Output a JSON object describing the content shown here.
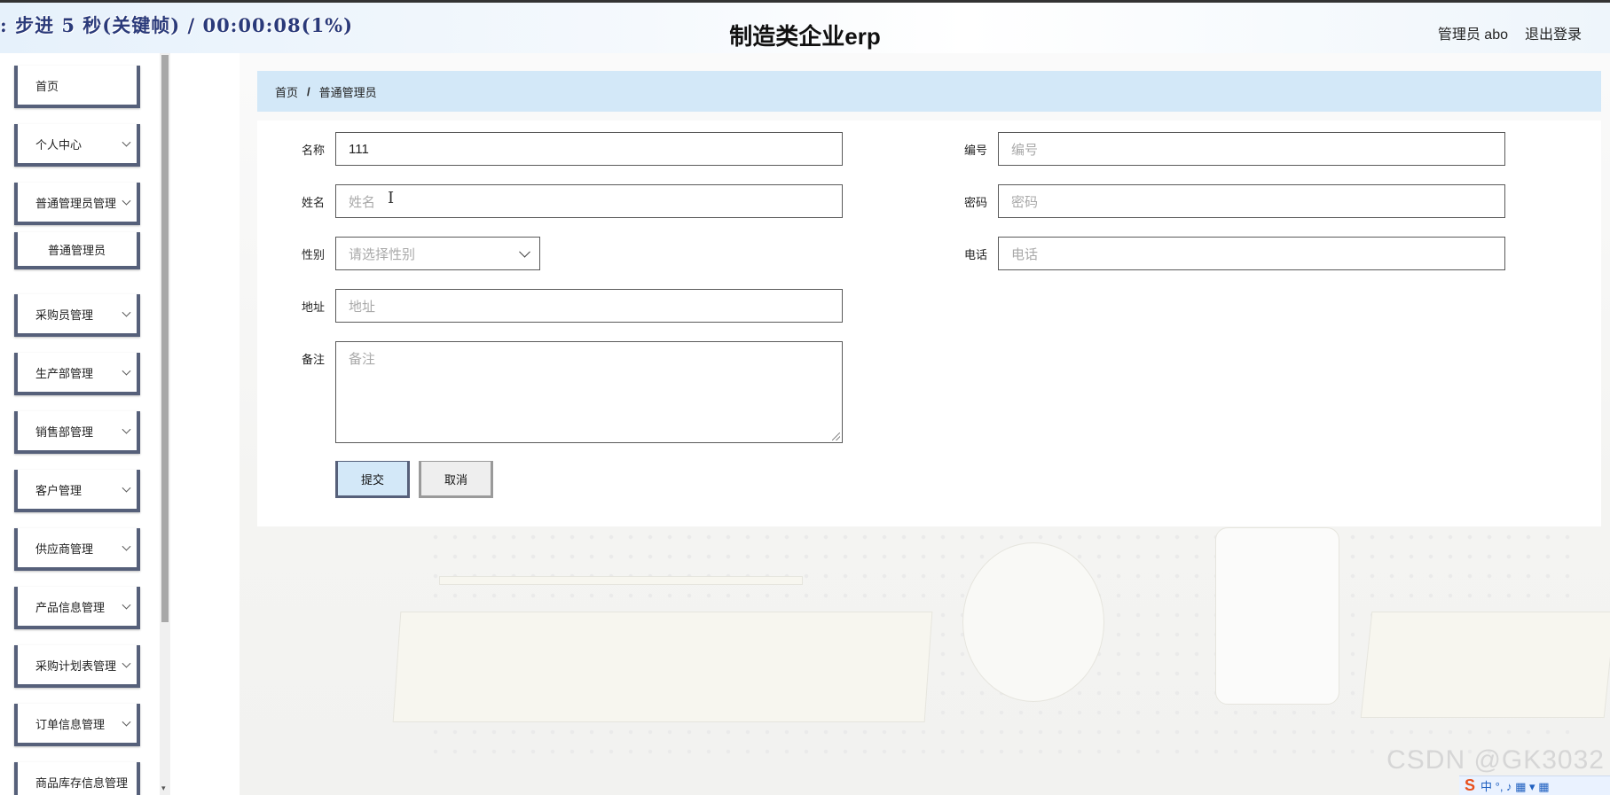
{
  "header": {
    "recorder_text": ": 步进 5 秒(关键帧) / 00:00:08(1%)",
    "title": "制造类企业erp",
    "user_label": "管理员 abo",
    "logout_label": "退出登录"
  },
  "sidebar": {
    "items": [
      {
        "label": "首页",
        "has_chevron": false
      },
      {
        "label": "个人中心",
        "has_chevron": true
      },
      {
        "label": "普通管理员管理",
        "has_chevron": true
      },
      {
        "label": "普通管理员",
        "has_chevron": false,
        "sub": true
      },
      {
        "label": "采购员管理",
        "has_chevron": true
      },
      {
        "label": "生产部管理",
        "has_chevron": true
      },
      {
        "label": "销售部管理",
        "has_chevron": true
      },
      {
        "label": "客户管理",
        "has_chevron": true
      },
      {
        "label": "供应商管理",
        "has_chevron": true
      },
      {
        "label": "产品信息管理",
        "has_chevron": true
      },
      {
        "label": "采购计划表管理",
        "has_chevron": true
      },
      {
        "label": "订单信息管理",
        "has_chevron": true
      },
      {
        "label": "商品库存信息管理",
        "has_chevron": false
      }
    ],
    "scroll_down_glyph": "▾"
  },
  "breadcrumb": {
    "home": "首页",
    "separator": "/",
    "current": "普通管理员"
  },
  "form": {
    "name": {
      "label": "名称",
      "value": "111",
      "placeholder": ""
    },
    "number": {
      "label": "编号",
      "value": "",
      "placeholder": "编号"
    },
    "fullname": {
      "label": "姓名",
      "value": "",
      "placeholder": "姓名"
    },
    "password": {
      "label": "密码",
      "value": "",
      "placeholder": "密码"
    },
    "gender": {
      "label": "性别",
      "value": "",
      "placeholder": "请选择性别"
    },
    "phone": {
      "label": "电话",
      "value": "",
      "placeholder": "电话"
    },
    "address": {
      "label": "地址",
      "value": "",
      "placeholder": "地址"
    },
    "remark": {
      "label": "备注",
      "value": "",
      "placeholder": "备注"
    },
    "submit_label": "提交",
    "cancel_label": "取消",
    "text_cursor_glyph": "I"
  },
  "overlay": {
    "watermark": "CSDN @GK3032",
    "ime_logo": "S",
    "ime_text": "中 °, ♪ ▦ ▾ ▦"
  },
  "colors": {
    "breadcrumb_bg": "#d3e8f8",
    "menu_border": "#56607a",
    "submit_bg": "#d3e8f8"
  },
  "icons": {
    "menu_chevron": "chevron-down-icon",
    "select_chevron": "chevron-down-icon"
  }
}
